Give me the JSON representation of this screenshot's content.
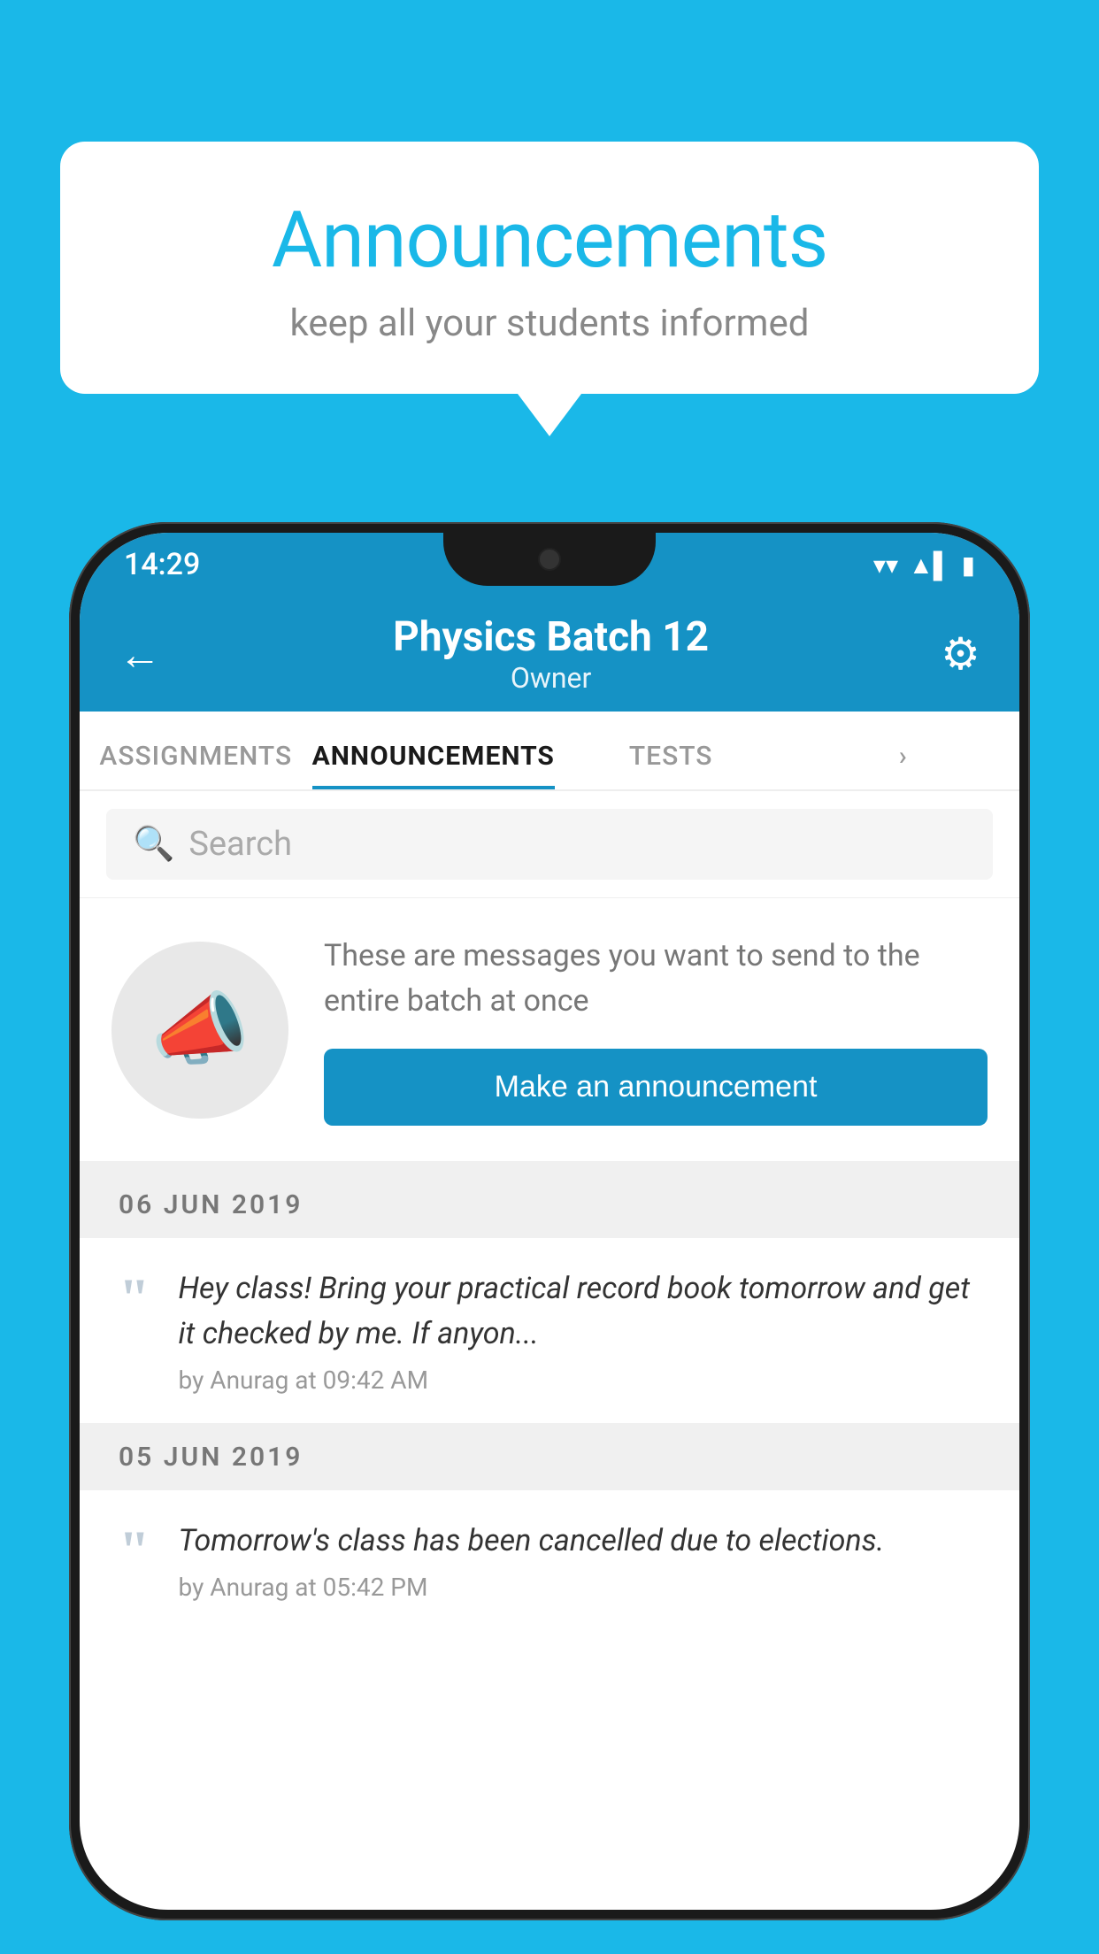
{
  "page": {
    "background_color": "#1ab8e8"
  },
  "speech_bubble": {
    "title": "Announcements",
    "subtitle": "keep all your students informed"
  },
  "phone": {
    "status_bar": {
      "time": "14:29",
      "wifi": "▼",
      "signal": "▲",
      "battery": "▮"
    },
    "header": {
      "back_label": "←",
      "title": "Physics Batch 12",
      "subtitle": "Owner",
      "gear_label": "⚙"
    },
    "tabs": [
      {
        "label": "ASSIGNMENTS",
        "active": false
      },
      {
        "label": "ANNOUNCEMENTS",
        "active": true
      },
      {
        "label": "TESTS",
        "active": false
      }
    ],
    "search": {
      "placeholder": "Search"
    },
    "announcement_prompt": {
      "description": "These are messages you want to send to the entire batch at once",
      "button_label": "Make an announcement"
    },
    "announcement_list": [
      {
        "date": "06  JUN  2019",
        "items": [
          {
            "text": "Hey class! Bring your practical record book tomorrow and get it checked by me. If anyon...",
            "meta": "by Anurag at 09:42 AM"
          }
        ]
      },
      {
        "date": "05  JUN  2019",
        "items": [
          {
            "text": "Tomorrow's class has been cancelled due to elections.",
            "meta": "by Anurag at 05:42 PM"
          }
        ]
      }
    ]
  }
}
